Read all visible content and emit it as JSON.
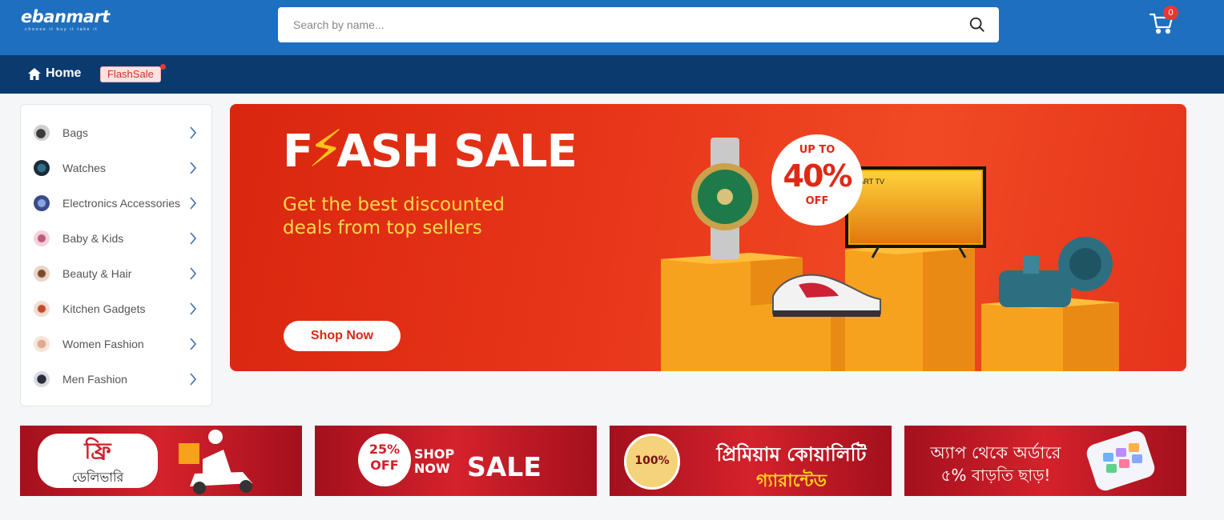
{
  "header": {
    "logo_text": "ebanmart",
    "logo_tagline": "choose it buy it take it",
    "search_placeholder": "Search by name...",
    "cart_count": "0",
    "brand_color": "#1e6fbf"
  },
  "nav": {
    "home_label": "Home",
    "flash_label": "FlashSale",
    "bg_color": "#0b3a6e"
  },
  "categories": [
    {
      "label": "Bags",
      "icon": "bag-thumb-icon"
    },
    {
      "label": "Watches",
      "icon": "watch-thumb-icon"
    },
    {
      "label": "Electronics Accessories",
      "icon": "electronics-thumb-icon"
    },
    {
      "label": "Baby & Kids",
      "icon": "baby-thumb-icon"
    },
    {
      "label": "Beauty & Hair",
      "icon": "beauty-thumb-icon"
    },
    {
      "label": "Kitchen Gadgets",
      "icon": "kitchen-thumb-icon"
    },
    {
      "label": "Women Fashion",
      "icon": "women-thumb-icon"
    },
    {
      "label": "Men Fashion",
      "icon": "men-thumb-icon"
    }
  ],
  "hero": {
    "title_pre": "F",
    "title_post": "ASH SALE",
    "subtitle": "Get the best discounted deals from top sellers",
    "button": "Shop Now",
    "promo_line1": "UP TO",
    "promo_line2": "40%",
    "promo_line3": "OFF",
    "tv_label": "MART TV",
    "accent_color": "#ffc21a"
  },
  "tiles": [
    {
      "line1": "ফ্রি",
      "line2": "ডেলিভারি"
    },
    {
      "badge_pct": "25%",
      "badge_off": "OFF",
      "shop": "SHOP",
      "now": "NOW",
      "sale": "SALE"
    },
    {
      "seal": "100%",
      "line1": "প্রিমিয়াম কোয়ালিটি",
      "line2": "গ্যারান্টেড"
    },
    {
      "line1": "অ্যাপ থেকে অর্ডারে",
      "line2": "৫% বাড়তি ছাড়!"
    }
  ]
}
